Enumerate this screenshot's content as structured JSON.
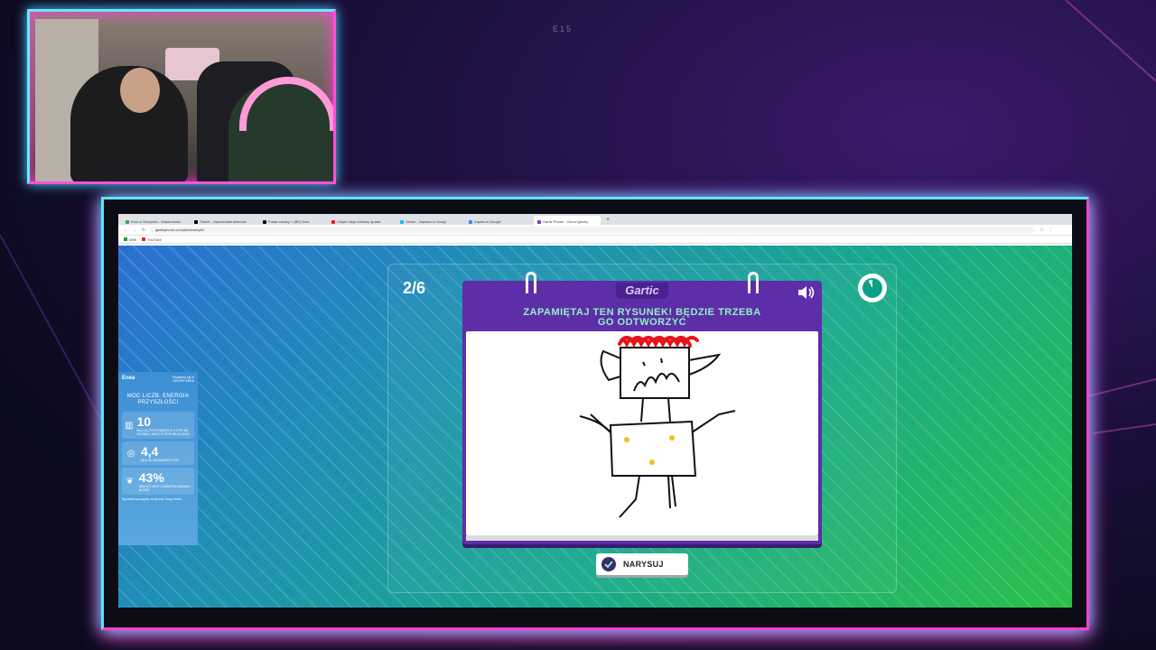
{
  "overlay": {
    "episode_label": "E15"
  },
  "browser": {
    "tabs": [
      {
        "label": "Ktoś w Skrzynka - Wiadomości"
      },
      {
        "label": "Twitch - Zapomniała dziennie"
      },
      {
        "label": "Pusta czadzy + (BD) Dice"
      },
      {
        "label": "Ciepło oleje reklamy aparat"
      },
      {
        "label": "Vimeo - Zapłacz w Googl"
      },
      {
        "label": "Zapisz w Google"
      },
      {
        "label": "Gartic Phone - Gra w głuchy"
      }
    ],
    "new_tab": "+",
    "url": "garticphone.com/pl/memory#2",
    "bookmarks": [
      {
        "label": "Web",
        "icon": "green-square-icon"
      },
      {
        "label": "YouTube",
        "icon": "youtube-icon"
      }
    ]
  },
  "ad": {
    "logo": "Enea",
    "tagline": "Skupiamy się w GRUPIE ENEA",
    "title": "MOC LICZB. ENERGIA PRZYSZŁOŚCI",
    "stats": [
      {
        "icon": "chart-icon",
        "value": "10",
        "desc": "MLD ZŁ POZYSKANYCH Z KPO NA ROZWÓJ SIECI DYSTRYBUCYJNEJ"
      },
      {
        "icon": "coins-icon",
        "value": "4,4",
        "desc": "MLD ZŁ NA INWESTYCJE"
      },
      {
        "icon": "plant-icon",
        "value": "43%",
        "desc": "WIĘCEJ MOCY ZAINSTALOWANEJ W OZE"
      }
    ],
    "footer": "Sprawdź szczegóły na stronie Grupy Enea"
  },
  "game": {
    "round": "2/6",
    "brand": "Gartic",
    "instruction_line1": "ZAPAMIĘTAJ TEN RYSUNEK! BĘDZIE TRZEBA",
    "instruction_line2": "GO ODTWORZYĆ",
    "draw_button": "NARYSUJ"
  },
  "colors": {
    "card_purple": "#5e2da8",
    "instruction_green": "#8ff1c2",
    "frame_cyan": "#5fe3ff",
    "frame_pink": "#ff3fd0"
  }
}
